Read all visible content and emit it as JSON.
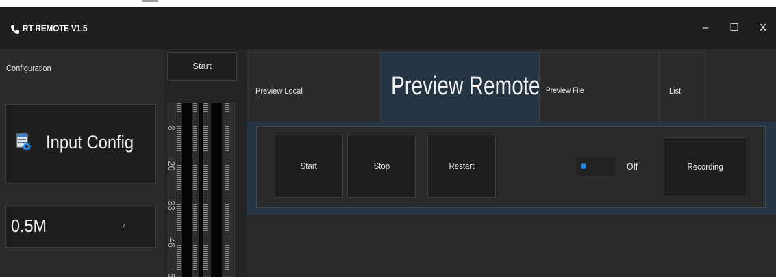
{
  "window": {
    "title": "RT REMOTE V1.5",
    "app_icon": "phone-icon",
    "controls": {
      "minimize": "–",
      "maximize": "☐",
      "close": "X"
    }
  },
  "sidebar": {
    "section_label": "Configuration",
    "input_config": {
      "label": "Input Config",
      "icon": "settings-form-icon"
    },
    "bitrate": {
      "value": "0.5M",
      "arrow": "›"
    }
  },
  "start_button": {
    "label": "Start"
  },
  "meter": {
    "scale_labels": [
      "-8",
      "-20",
      "-33",
      "-46",
      "-5"
    ]
  },
  "tabs": [
    {
      "label": "Preview Local",
      "active": false
    },
    {
      "label": "Preview Remote",
      "active": true
    },
    {
      "label": "Preview File",
      "active": false
    },
    {
      "label": "List",
      "active": false
    }
  ],
  "controls": {
    "start_label": "Start",
    "stop_label": "Stop",
    "restart_label": "Restart",
    "toggle_state": "Off",
    "recording_label": "Recording"
  },
  "colors": {
    "accent": "#1e8ae6",
    "active_tab": "#263544",
    "background": "#252526"
  }
}
